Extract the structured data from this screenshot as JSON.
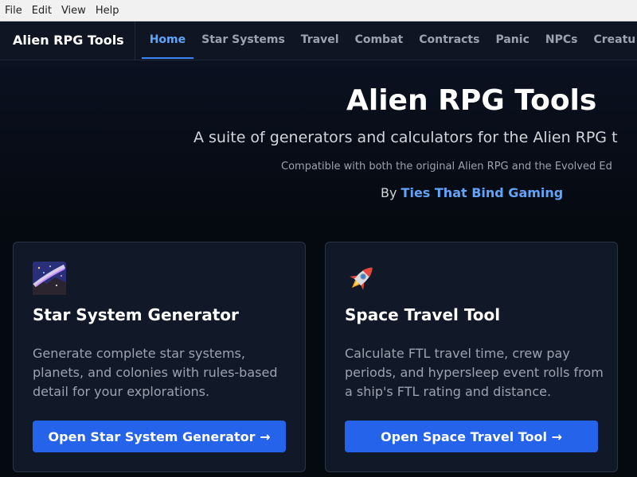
{
  "menubar": {
    "items": [
      "File",
      "Edit",
      "View",
      "Help"
    ]
  },
  "nav": {
    "brand": "Alien RPG Tools",
    "links": [
      "Home",
      "Star Systems",
      "Travel",
      "Combat",
      "Contracts",
      "Panic",
      "NPCs",
      "Creatu"
    ],
    "active_link": "Home"
  },
  "hero": {
    "title": "Alien RPG Tools",
    "subtitle": "A suite of generators and calculators for the Alien RPG t",
    "compat": "Compatible with both the original Alien RPG and the Evolved Ed",
    "by_prefix": "By",
    "by_link": "Ties That Bind Gaming"
  },
  "cards": [
    {
      "icon": "milky-way-icon",
      "title": "Star System Generator",
      "description": "Generate complete star systems, planets, and colonies with rules-based detail for your explorations.",
      "button": "Open Star System Generator →"
    },
    {
      "icon": "rocket-icon",
      "title": "Space Travel Tool",
      "description": "Calculate FTL travel time, crew pay periods, and hypersleep event rolls from a ship's FTL rating and distance.",
      "button": "Open Space Travel Tool →"
    }
  ],
  "colors": {
    "accent": "#2563eb",
    "link": "#60a5fa",
    "background": "#050910",
    "card": "#111827"
  }
}
